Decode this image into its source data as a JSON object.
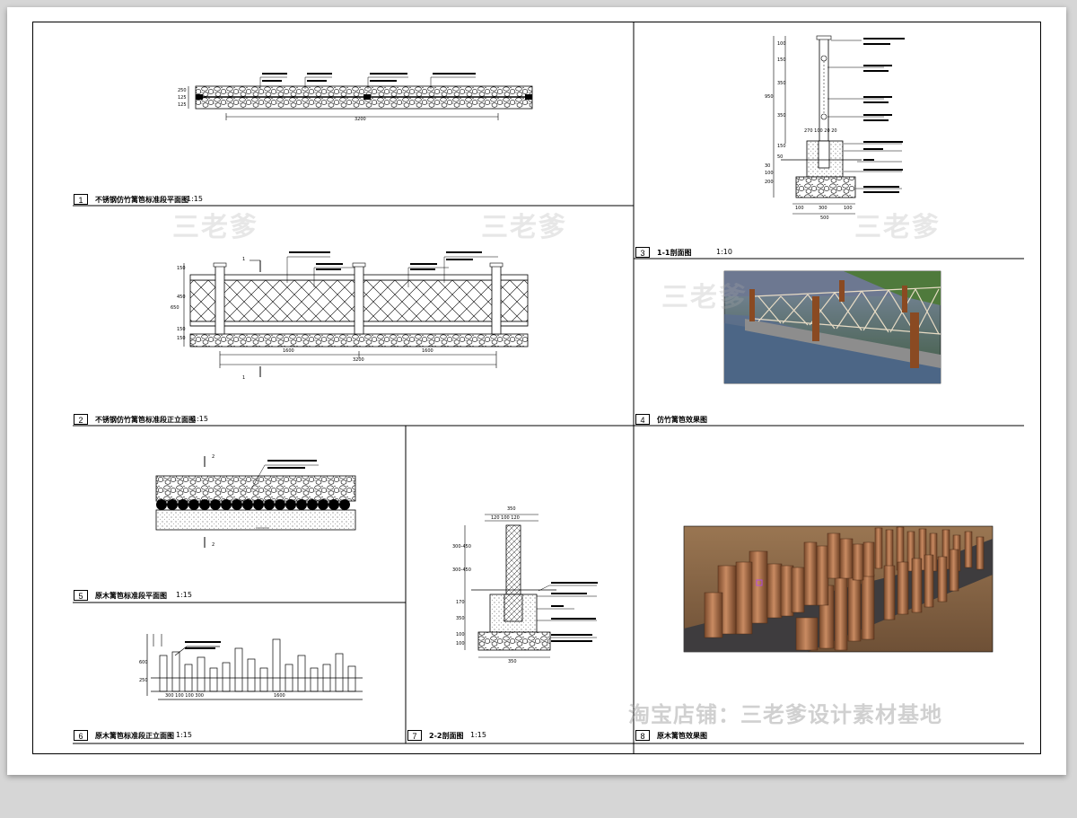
{
  "panels": [
    {
      "num": "1",
      "title": "不锈钢仿竹篱笆标准段平面图",
      "scale": "1:15"
    },
    {
      "num": "2",
      "title": "不锈钢仿竹篱笆标准段正立面图",
      "scale": "1:15"
    },
    {
      "num": "3",
      "title": "1-1剖面图",
      "scale": "1:10"
    },
    {
      "num": "4",
      "title": "仿竹篱笆效果图",
      "scale": ""
    },
    {
      "num": "5",
      "title": "原木篱笆标准段平面图",
      "scale": "1:15"
    },
    {
      "num": "6",
      "title": "原木篱笆标准段正立面图",
      "scale": "1:15"
    },
    {
      "num": "7",
      "title": "2-2剖面图",
      "scale": "1:15"
    },
    {
      "num": "8",
      "title": "原木篱笆效果图",
      "scale": ""
    }
  ],
  "dims": {
    "p1_total": "3200",
    "p1_left": [
      "250",
      "125",
      "125"
    ],
    "p2_left": [
      "150",
      "450",
      "650",
      "150",
      "150"
    ],
    "p2_half": "1600",
    "p2_total": "3200",
    "p2_sec1": "1",
    "p3_top": [
      "100",
      "150",
      "350",
      "350",
      "150",
      "50"
    ],
    "p3_left": [
      "950",
      "30",
      "100",
      "200"
    ],
    "p3_bottom": [
      "100",
      "300",
      "100"
    ],
    "p3_total": "500",
    "p3_mid": "270 100 20 20",
    "p5_sec": "2",
    "p6_left": [
      "600",
      "250"
    ],
    "p6_bottom": "300 100 100 300",
    "p6_total": "1600",
    "p7_top": "350",
    "p7_topsub": "120  100  120",
    "p7_left": [
      "300-450",
      "300-450",
      "170",
      "350",
      "100",
      "100"
    ],
    "p7_bottom": "350"
  },
  "watermarks": {
    "mark": "三老爹",
    "footer": "淘宝店铺：三老爹设计素材基地"
  },
  "colors": {
    "line": "#000000",
    "sheet": "#ffffff",
    "background": "#d6d6d6"
  }
}
